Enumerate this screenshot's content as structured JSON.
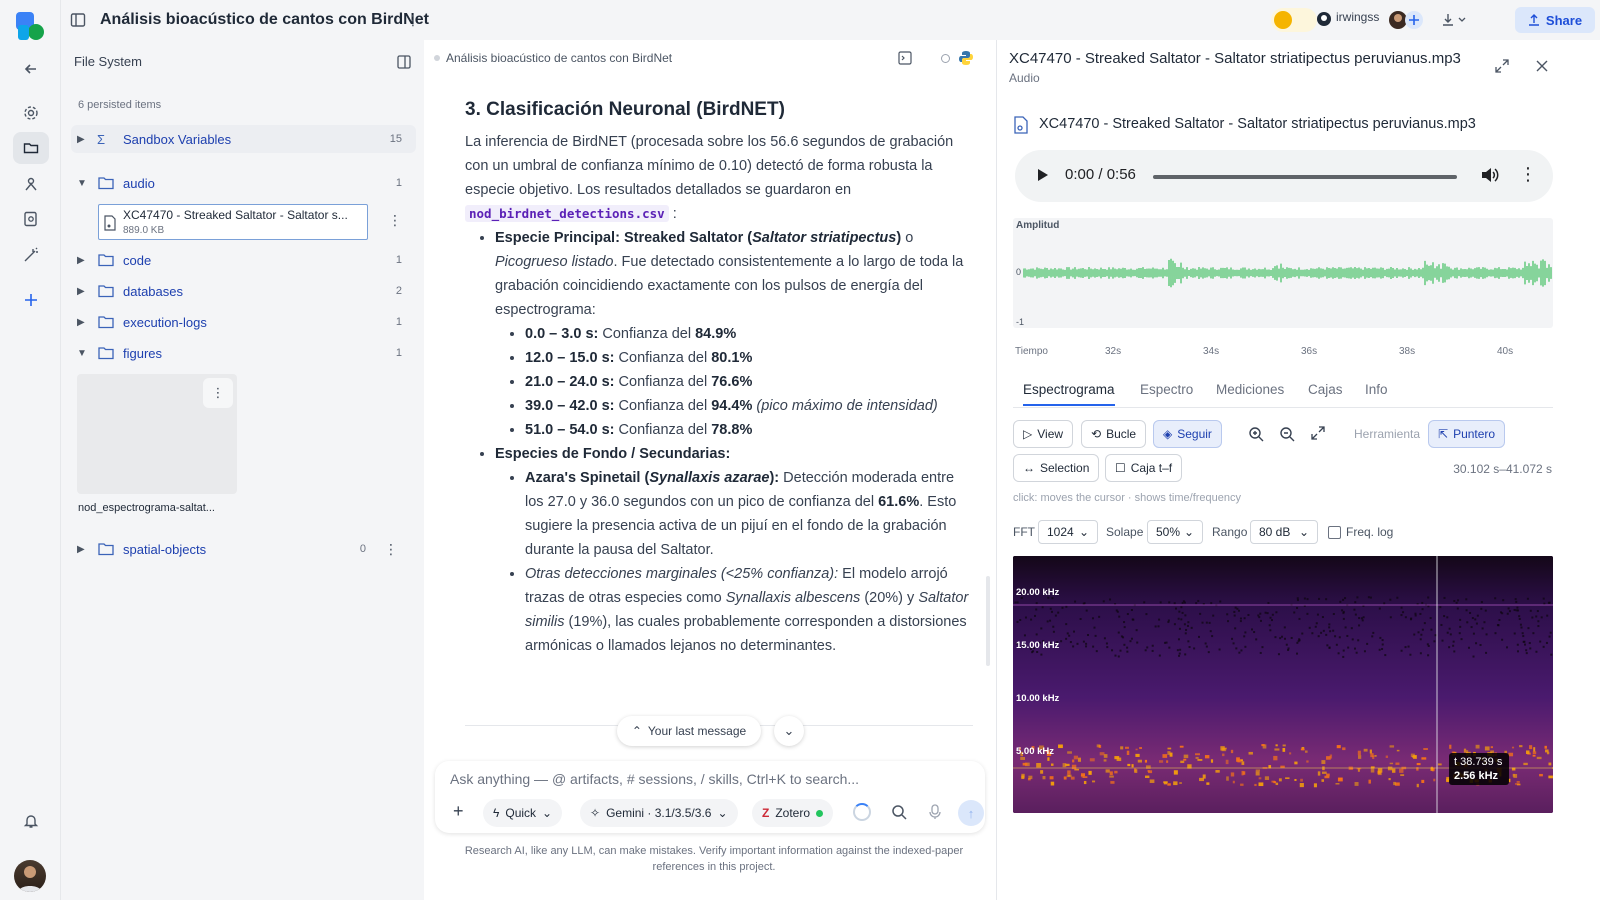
{
  "window": {
    "title": "Análisis bioacústico de cantos con BirdNet",
    "user": "irwingss",
    "share_label": "Share"
  },
  "files": {
    "header": "File System",
    "persisted": "6 persisted items",
    "rows": [
      {
        "label": "Sandbox Variables",
        "count": "15"
      },
      {
        "label": "audio",
        "count": "1"
      },
      {
        "label": "code",
        "count": "1"
      },
      {
        "label": "databases",
        "count": "2"
      },
      {
        "label": "execution-logs",
        "count": "1"
      },
      {
        "label": "figures",
        "count": "1"
      },
      {
        "label": "spatial-objects",
        "count": "0"
      }
    ],
    "audio_file": {
      "name": "XC47470 - Streaked Saltator - Saltator s...",
      "size": "889.0 KB"
    },
    "figure_name": "nod_espectrograma-saltat..."
  },
  "chat": {
    "breadcrumb": "Análisis bioacústico de cantos con BirdNet",
    "heading": "3. Clasificación Neuronal (BirdNET)",
    "intro": "La inferencia de BirdNET (procesada sobre los 56.6 segundos de grabación con un umbral de confianza mínimo de 0.10) detectó de forma robusta la especie objetivo. Los resultados detallados se guardaron en",
    "csv": "nod_birdnet_detections.csv",
    "colon": ":",
    "primary_lead": "Especie Principal: Streaked Saltator (",
    "primary_sci": "Saltator striatipectus",
    "primary_close": ")",
    "primary_o": " o ",
    "primary_common": "Picogrueso listado",
    "primary_rest": ". Fue detectado consistentemente a lo largo de toda la grabación coincidiendo exactamente con los pulsos de energía del espectrograma:",
    "detections": [
      {
        "range": "0.0 – 3.0 s:",
        "text": " Confianza del ",
        "conf": "84.9%",
        "note": ""
      },
      {
        "range": "12.0 – 15.0 s:",
        "text": " Confianza del ",
        "conf": "80.1%",
        "note": ""
      },
      {
        "range": "21.0 – 24.0 s:",
        "text": " Confianza del ",
        "conf": "76.6%",
        "note": ""
      },
      {
        "range": "39.0 – 42.0 s:",
        "text": " Confianza del ",
        "conf": "94.4%",
        "note": " (pico máximo de intensidad)"
      },
      {
        "range": "51.0 – 54.0 s:",
        "text": " Confianza del ",
        "conf": "78.8%",
        "note": ""
      }
    ],
    "background_heading": "Especies de Fondo / Secundarias:",
    "azara_lead": "Azara's Spinetail (",
    "azara_sci": "Synallaxis azarae",
    "azara_close": "):",
    "azara_rest": " Detección moderada entre los 27.0 y 36.0 segundos con un pico de confianza del ",
    "azara_conf": "61.6%",
    "azara_tail": ". Esto sugiere la presencia activa de un pijuí en el fondo de la grabación durante la pausa del Saltator.",
    "other_lead": "Otras detecciones marginales (<25% confianza):",
    "other_mid": " El modelo arrojó trazas de otras especies como ",
    "other_sp1": "Synallaxis albescens",
    "other_mid2": " (20%) y ",
    "other_sp2": "Saltator similis",
    "other_tail": " (19%), las cuales probablemente corresponden a distorsiones armónicas o llamados lejanos no determinantes.",
    "last_message": "Your last message",
    "placeholder": "Ask anything — @ artifacts, # sessions, / skills, Ctrl+K to search...",
    "mode": "Quick",
    "model": "Gemini · 3.1/3.5/3.6",
    "integration": "Zotero",
    "disclaimer": "Research AI, like any LLM, can make mistakes. Verify important information against the indexed-paper references in this project."
  },
  "viewer": {
    "title": "XC47470 - Streaked Saltator - Saltator striatipectus peruvianus.mp3",
    "subtitle": "Audio",
    "file_label": "XC47470 - Streaked Saltator - Saltator striatipectus peruvianus.mp3",
    "time": "0:00 / 0:56",
    "amp_label": "Amplitud",
    "amp_zero": "0",
    "amp_neg": "-1",
    "time_labels": [
      "Tiempo",
      "32s",
      "34s",
      "36s",
      "38s",
      "40s"
    ],
    "tabs": [
      "Espectrograma",
      "Espectro",
      "Mediciones",
      "Cajas",
      "Info"
    ],
    "tools": {
      "view": "View",
      "loop": "Bucle",
      "follow": "Seguir",
      "tool_label": "Herramienta",
      "pointer": "Puntero",
      "selection": "Selection",
      "box": "Caja t–f"
    },
    "range": "30.102 s–41.072 s",
    "hint": "click: moves the cursor · shows time/frequency",
    "fft_label": "FFT",
    "fft": "1024",
    "overlap_label": "Solape",
    "overlap": "50%",
    "range_label": "Rango",
    "db_range": "80 dB",
    "freq_log": "Freq. log",
    "freq_labels": [
      "20.00 kHz",
      "15.00 kHz",
      "10.00 kHz",
      "5.00 kHz"
    ],
    "cursor_time": "t 38.739 s",
    "cursor_freq": "2.56 kHz"
  }
}
